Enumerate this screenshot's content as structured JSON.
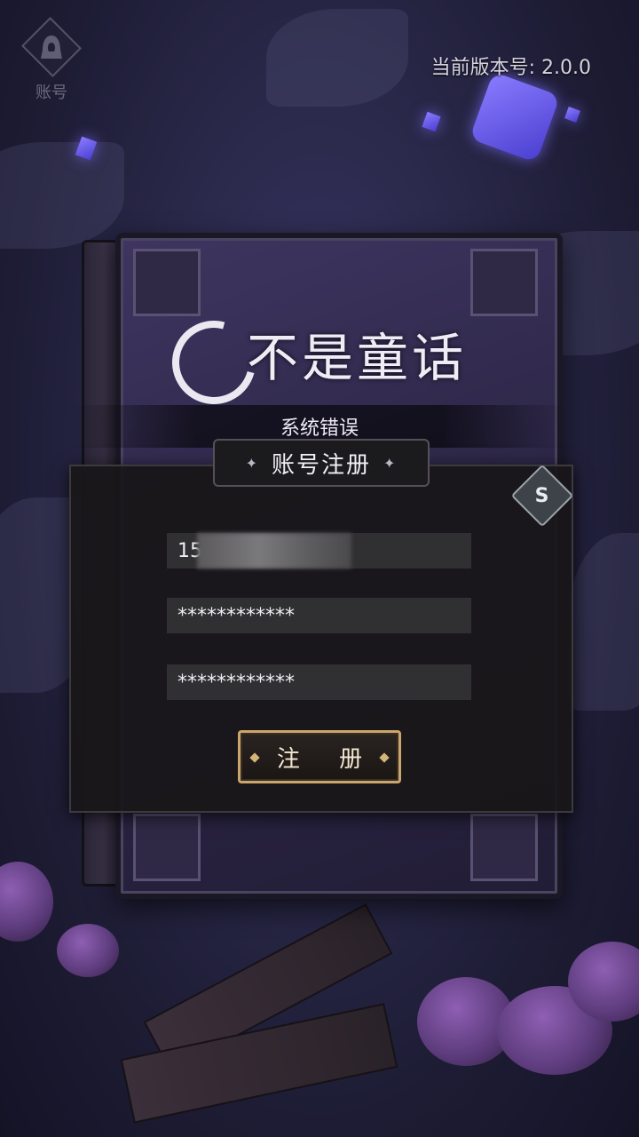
{
  "top_bar": {
    "account_label": "账号",
    "account_icon": "hooded-figure-icon",
    "version_text": "当前版本号:  2.0.0"
  },
  "logo": {
    "text": "不是童话"
  },
  "error_banner": {
    "text": "系统错误"
  },
  "dialog": {
    "title": "账号注册",
    "close_icon": "close-icon",
    "fields": {
      "phone_value": "15",
      "password_value": "************",
      "confirm_password_value": "************"
    },
    "register_label": "注 册"
  },
  "colors": {
    "background": "#2b2a4c",
    "dialog_bg": "#181618",
    "input_bg": "#302f31",
    "button_border": "#c9a66b"
  }
}
